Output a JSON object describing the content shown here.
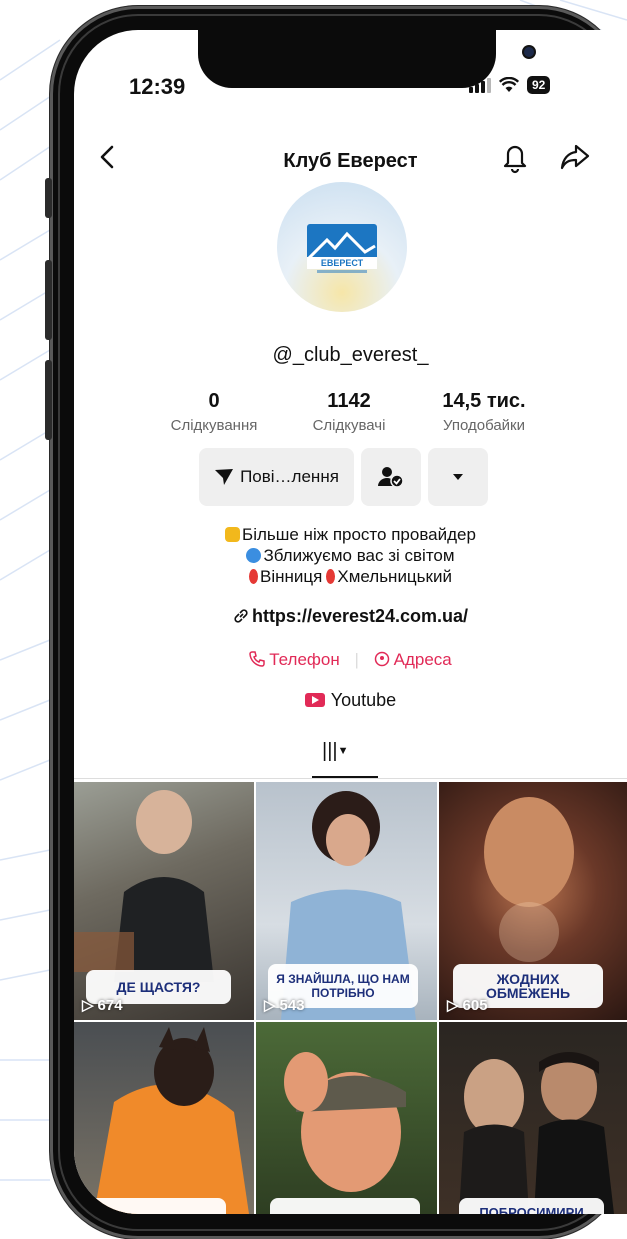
{
  "status": {
    "time": "12:39",
    "battery": "92"
  },
  "nav": {
    "title": "Клуб Еверест"
  },
  "profile": {
    "username": "@_club_everest_",
    "logo_text": "ЕВЕРЕСТ",
    "stats": [
      {
        "value": "0",
        "label": "Слідкування"
      },
      {
        "value": "1142",
        "label": "Слідкувачі"
      },
      {
        "value": "14,5 тис.",
        "label": "Уподобайки"
      }
    ],
    "message_button": "Пові…лення",
    "bio": [
      "Більше ніж просто провайдер",
      "Зближуємо вас зі світом",
      "Вінниця",
      "Хмельницький"
    ],
    "link": "https://everest24.com.ua/",
    "phone_label": "Телефон",
    "address_label": "Адреса",
    "youtube_label": "Youtube"
  },
  "videos": [
    {
      "caption": "ДЕ ЩАСТЯ?",
      "views": "674"
    },
    {
      "caption": "Я ЗНАЙШЛА, ЩО НАМ ПОТРІБНО",
      "views": "543"
    },
    {
      "caption": "ЖОДНИХ ОБМЕЖЕНЬ",
      "views": "605"
    },
    {
      "caption": "",
      "views": ""
    },
    {
      "caption": "",
      "views": ""
    },
    {
      "caption": "ПОБРОСИМИРИ",
      "views": ""
    }
  ],
  "colors": {
    "accent": "#e12a57",
    "caption_text": "#1d2f7a",
    "brand_blue": "#1c76c2"
  }
}
